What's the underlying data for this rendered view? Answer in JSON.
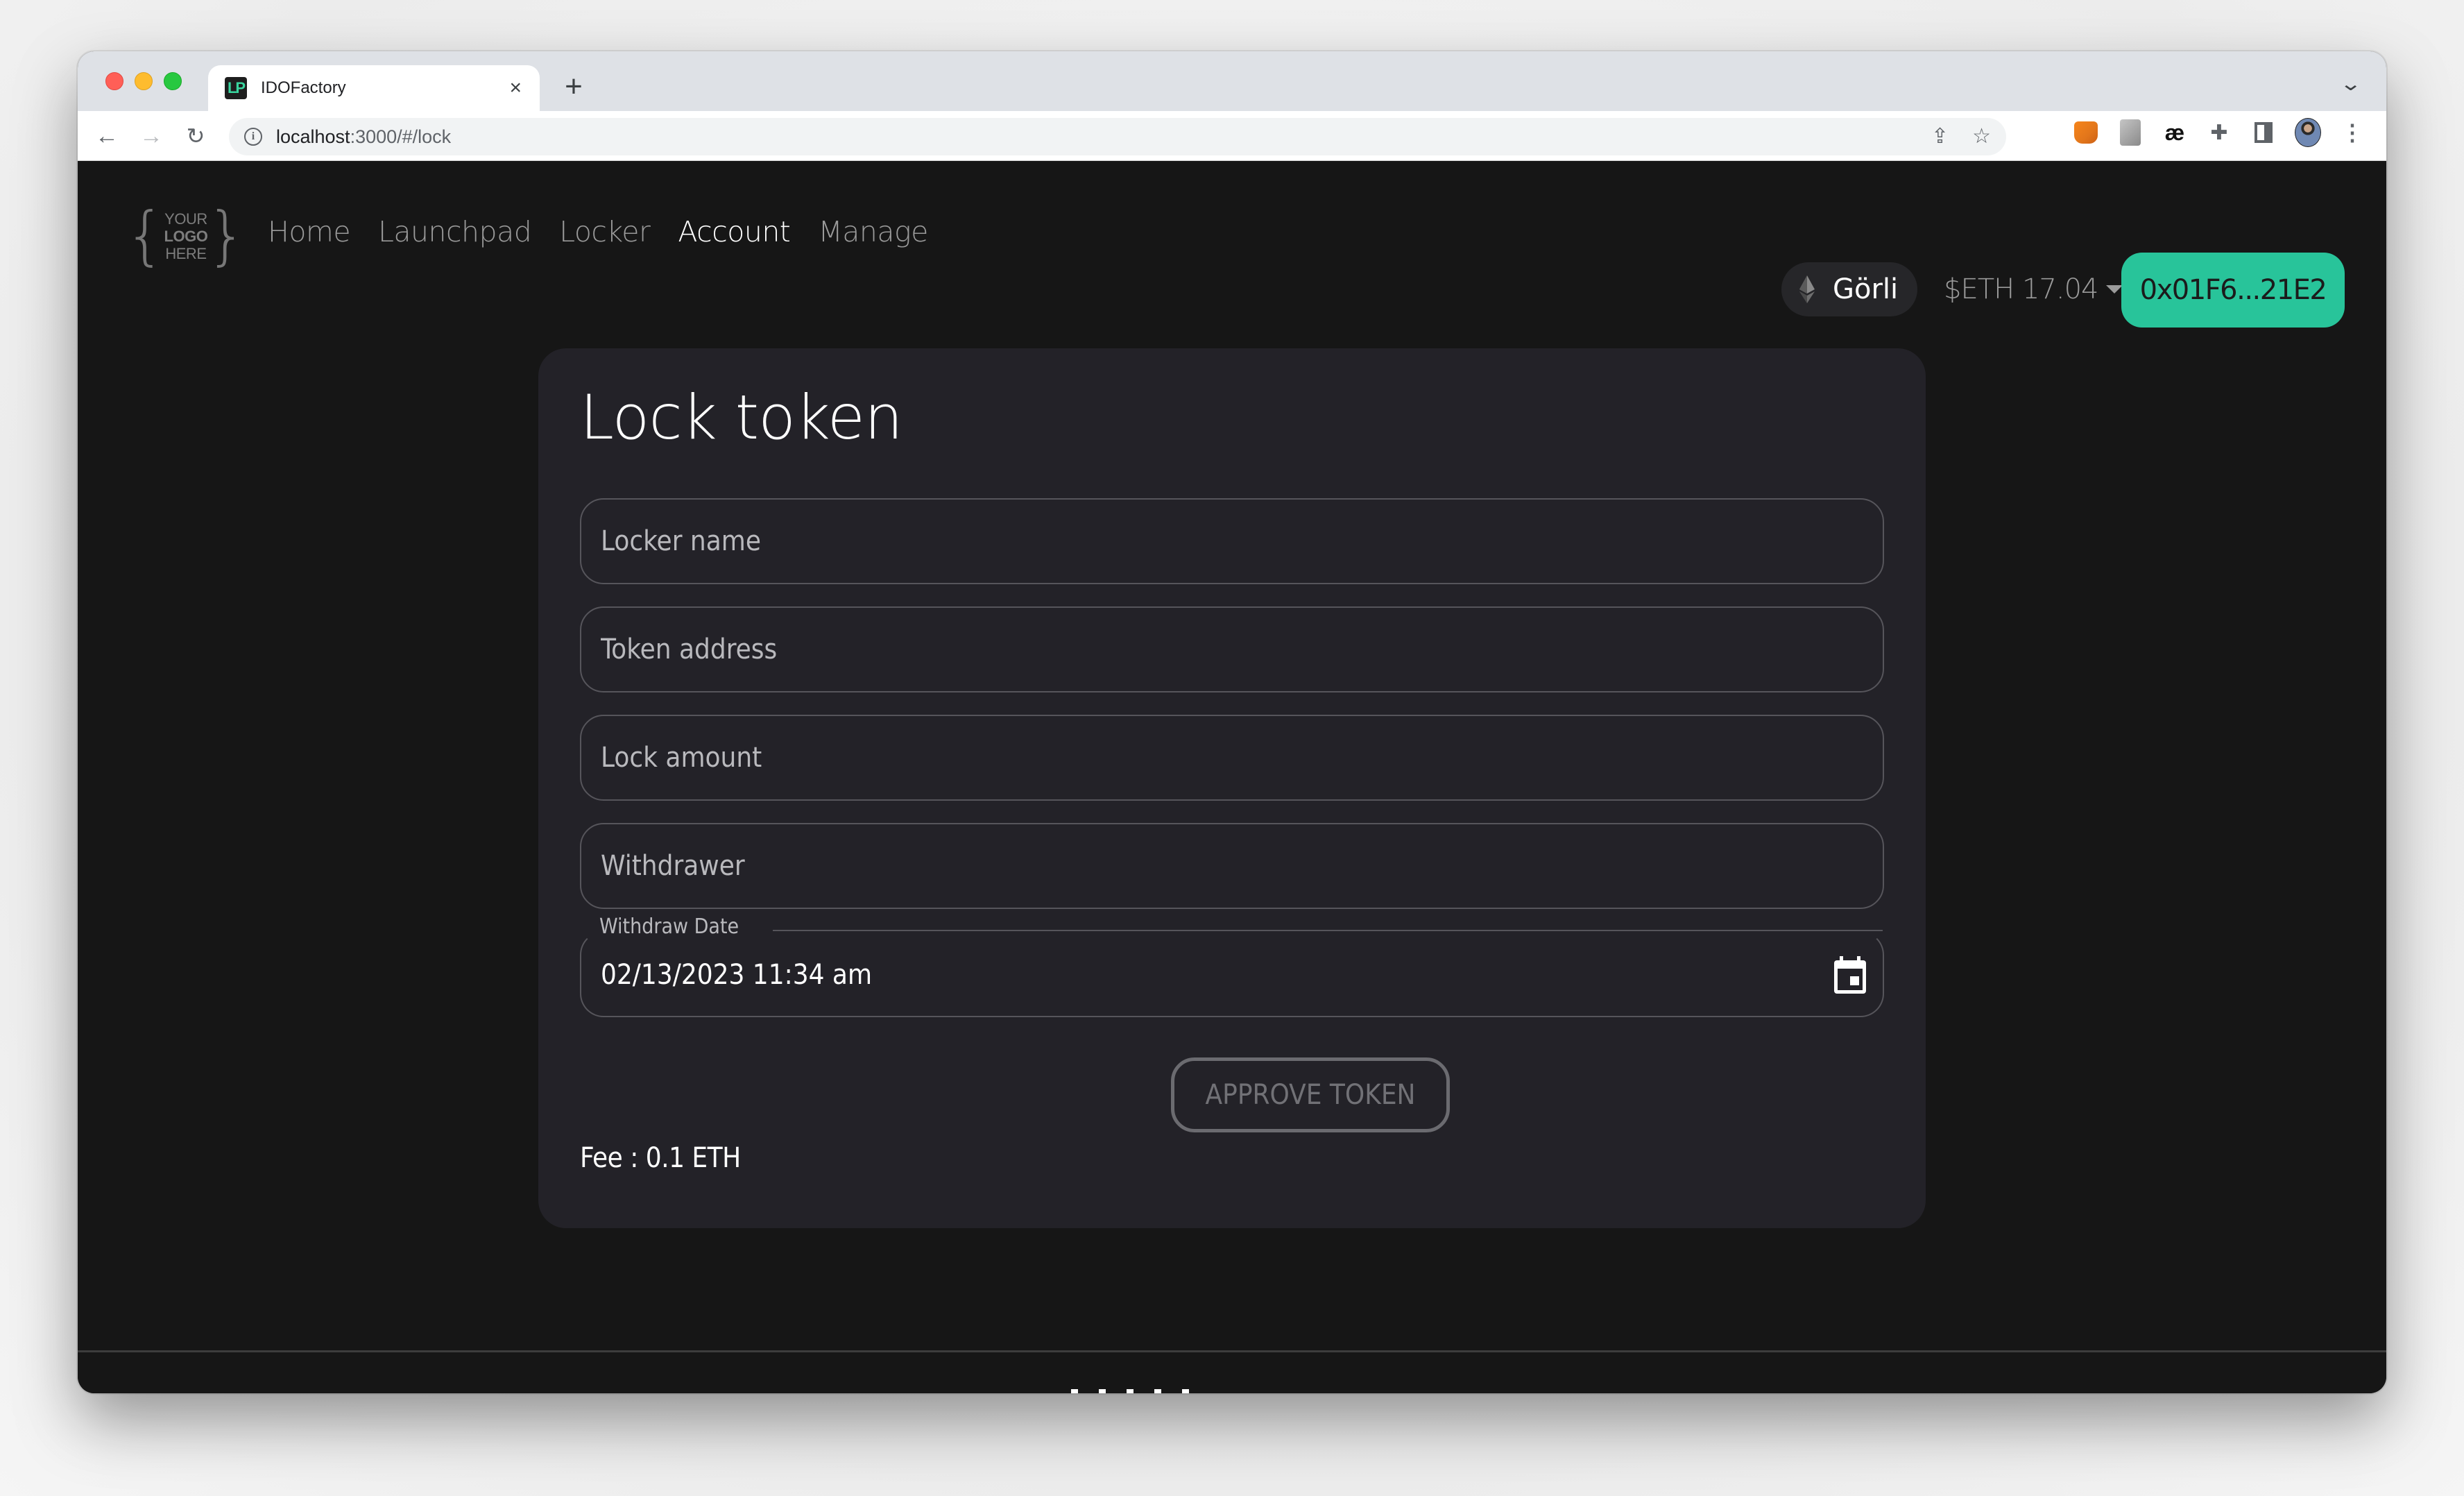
{
  "browser": {
    "tab": {
      "title": "IDOFactory",
      "favicon_text": "LP",
      "close_glyph": "×"
    },
    "new_tab_glyph": "+",
    "tabstrip_chevron_glyph": "⌄",
    "nav": {
      "back_glyph": "←",
      "forward_glyph": "→",
      "reload_glyph": "↻"
    },
    "url": {
      "host": "localhost",
      "path": ":3000/#/lock"
    },
    "icons": {
      "info": "info-icon",
      "share": "share-icon",
      "bookmark": "star-icon",
      "extensions": [
        "metamask-icon",
        "tap-extension-icon",
        "ae-extension-icon",
        "puzzle-extensions-icon",
        "side-panel-icon"
      ],
      "profile": "profile-avatar",
      "menu": "kebab-menu-icon"
    },
    "glyphs": {
      "share": "⇪",
      "star": "☆",
      "ae": "æ",
      "puzzle": "✚",
      "menu": "⋮"
    }
  },
  "header": {
    "logo": {
      "line1": "YOUR",
      "line2": "LOGO",
      "line3": "HERE"
    },
    "nav_items": [
      {
        "label": "Home",
        "active": false
      },
      {
        "label": "Launchpad",
        "active": false
      },
      {
        "label": "Locker",
        "active": false
      },
      {
        "label": "Account",
        "active": true
      },
      {
        "label": "Manage",
        "active": false
      }
    ],
    "network": {
      "label": "Görli",
      "icon": "ethereum-icon"
    },
    "balance": {
      "label": "$ETH 17.04"
    },
    "wallet_address": "0x01F6...21E2",
    "accent_color": "#28c49a"
  },
  "lock_form": {
    "title": "Lock token",
    "fields": {
      "locker_name": {
        "placeholder": "Locker name",
        "value": ""
      },
      "token_address": {
        "placeholder": "Token address",
        "value": ""
      },
      "lock_amount": {
        "placeholder": "Lock amount",
        "value": ""
      },
      "withdrawer": {
        "placeholder": "Withdrawer",
        "value": ""
      },
      "withdraw_date": {
        "label": "Withdraw Date",
        "value": "02/13/2023 11:34 am"
      }
    },
    "approve_button": "APPROVE TOKEN",
    "fee": "Fee : 0.1 ETH"
  }
}
